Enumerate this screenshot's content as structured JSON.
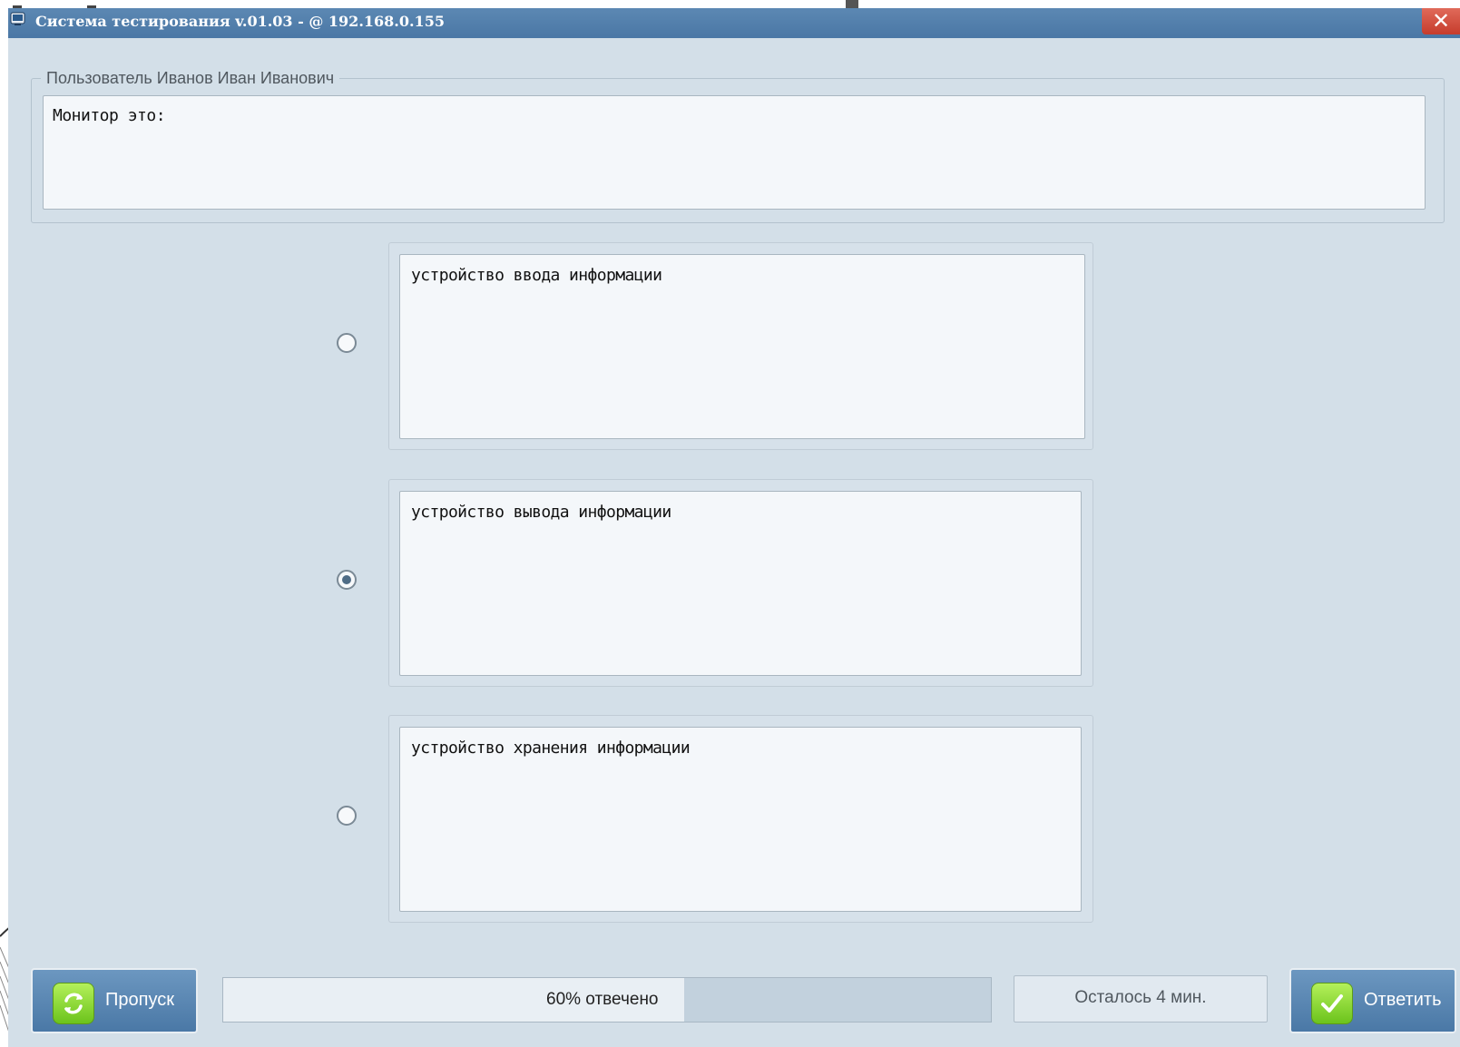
{
  "window": {
    "title": "Система тестирования v.01.03 -  @ 192.168.0.155",
    "close_label": "✕"
  },
  "user": {
    "legend": "Пользователь Иванов Иван Иванович"
  },
  "question": {
    "text": "Монитор это:"
  },
  "answers": [
    {
      "text": "устройство ввода информации",
      "selected": false
    },
    {
      "text": "устройство вывода информации",
      "selected": true
    },
    {
      "text": "устройство хранения информации",
      "selected": false
    }
  ],
  "footer": {
    "skip_label": "Пропуск",
    "progress_text": "60% отвечено",
    "progress_fraction": 0.6,
    "timer_text": "Осталось 4 мин.",
    "submit_label": "Ответить"
  },
  "colors": {
    "titlebar": "#4a77a5",
    "window_bg": "#d3dfe8",
    "button": "#4a78a6",
    "icon_green": "#6cc31c",
    "close_red": "#c63c2c"
  },
  "icons": {
    "app": "app-window-icon",
    "close": "close-icon",
    "skip": "refresh-icon",
    "submit": "checkmark-icon"
  }
}
